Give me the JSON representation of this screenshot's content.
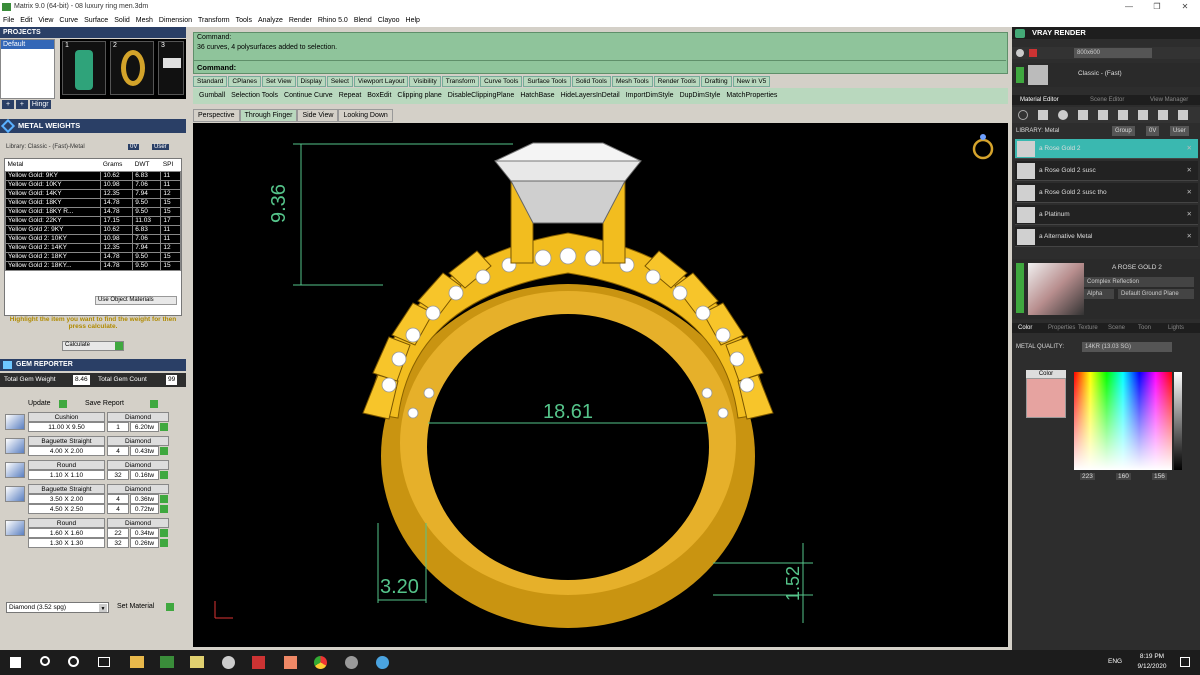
{
  "window": {
    "title": "Matrix 9.0 (64-bit) - 08 luxury ring men.3dm",
    "min": "—",
    "max": "❐",
    "close": "✕"
  },
  "menu": [
    "File",
    "Edit",
    "View",
    "Curve",
    "Surface",
    "Solid",
    "Mesh",
    "Dimension",
    "Transform",
    "Tools",
    "Analyze",
    "Render",
    "Rhino 5.0",
    "Blend",
    "Clayoo",
    "Help"
  ],
  "projects": {
    "title": "PROJECTS",
    "item": "Default",
    "thumbs": [
      "1",
      "2",
      "3"
    ],
    "hinge": "Hingr"
  },
  "metal": {
    "title": "METAL WEIGHTS",
    "library": "Library: Classic - (Fast)-Metal",
    "library_short": "0V",
    "user": "User",
    "headers": [
      "Metal",
      "Grams",
      "DWT",
      "SPI"
    ],
    "rows": [
      [
        "Yellow Gold: 9KY",
        "10.62",
        "6.83",
        "11"
      ],
      [
        "Yellow Gold: 10KY",
        "10.98",
        "7.06",
        "11"
      ],
      [
        "Yellow Gold: 14KY",
        "12.35",
        "7.94",
        "12"
      ],
      [
        "Yellow Gold: 18KY",
        "14.78",
        "9.50",
        "15"
      ],
      [
        "Yellow Gold: 18KY R...",
        "14.78",
        "9.50",
        "15"
      ],
      [
        "Yellow Gold: 22KY",
        "17.15",
        "11.03",
        "17"
      ],
      [
        "Yellow Gold 2: 9KY",
        "10.62",
        "6.83",
        "11"
      ],
      [
        "Yellow Gold 2: 10KY",
        "10.98",
        "7.06",
        "11"
      ],
      [
        "Yellow Gold 2: 14KY",
        "12.35",
        "7.94",
        "12"
      ],
      [
        "Yellow Gold 2: 18KY",
        "14.78",
        "9.50",
        "15"
      ],
      [
        "Yellow Gold 2: 18KY...",
        "14.78",
        "9.50",
        "15"
      ]
    ],
    "use_object": "Use Object Materials",
    "hint": "Highlight the item you want to find the weight for then press calculate.",
    "calculate": "Calculate"
  },
  "gems": {
    "title": "GEM REPORTER",
    "total_weight_label": "Total Gem Weight",
    "total_weight": "8.46",
    "total_count_label": "Total Gem Count",
    "total_count": "99",
    "update": "Update",
    "save_report": "Save Report",
    "groups": [
      {
        "shape": "Cushion",
        "material": "Diamond",
        "rows": [
          [
            "11.00 X 9.50",
            "1",
            "6.20tw"
          ]
        ]
      },
      {
        "shape": "Baguette Straight",
        "material": "Diamond",
        "rows": [
          [
            "4.00 X 2.00",
            "4",
            "0.43tw"
          ]
        ]
      },
      {
        "shape": "Round",
        "material": "Diamond",
        "rows": [
          [
            "1.10 X 1.10",
            "32",
            "0.16tw"
          ]
        ]
      },
      {
        "shape": "Baguette Straight",
        "material": "Diamond",
        "rows": [
          [
            "3.50 X 2.00",
            "4",
            "0.36tw"
          ],
          [
            "4.50 X 2.50",
            "4",
            "0.72tw"
          ]
        ]
      },
      {
        "shape": "Round",
        "material": "Diamond",
        "rows": [
          [
            "1.60 X 1.60",
            "22",
            "0.34tw"
          ],
          [
            "1.30 X 1.30",
            "32",
            "0.26tw"
          ]
        ]
      }
    ],
    "material_select": "Diamond    (3.52 spg)",
    "set_material": "Set Material"
  },
  "command": {
    "line1": "Command:",
    "line2": "36 curves, 4 polysurfaces added to selection.",
    "prompt": "Command:"
  },
  "toolbar_tabs": [
    "Standard",
    "CPlanes",
    "Set View",
    "Display",
    "Select",
    "Viewport Layout",
    "Visibility",
    "Transform",
    "Curve Tools",
    "Surface Tools",
    "Solid Tools",
    "Mesh Tools",
    "Render Tools",
    "Drafting",
    "New in V5"
  ],
  "tools": [
    "Gumball",
    "Selection Tools",
    "Continue Curve",
    "Repeat",
    "BoxEdit",
    "Clipping plane",
    "DisableClippingPlane",
    "HatchBase",
    "HideLayersInDetail",
    "ImportDimStyle",
    "DupDimStyle",
    "MatchProperties"
  ],
  "view_tabs": [
    "Perspective",
    "Through Finger",
    "Side View",
    "Looking Down"
  ],
  "active_view": "Through Finger",
  "dimensions": {
    "height": "9.36",
    "inner": "18.61",
    "shank": "3.20",
    "thickness": "1.52"
  },
  "vray": {
    "title": "VRAY RENDER",
    "resolution": "800x600",
    "preset": "Classic - (Fast)",
    "tabs": [
      "Material Editor",
      "Scene Editor",
      "View Manager"
    ],
    "library": "LIBRARY: Metal",
    "group": "Group",
    "short": "0V",
    "user": "User",
    "items": [
      "a Rose Gold 2",
      "a Rose Gold 2 susc",
      "a Rose Gold 2 susc tho",
      "a Platinum",
      "a Alternative Metal"
    ],
    "selected": "A ROSE GOLD 2",
    "reflection": "Complex Reflection",
    "alpha": "Alpha",
    "ground": "Default Ground Plane",
    "prop_tabs": [
      "Color",
      "Properties",
      "Texture",
      "Scene",
      "Toon",
      "Lights"
    ],
    "metal_quality_label": "METAL QUALITY:",
    "metal_quality": "14KR",
    "metal_quality_sg": "(13.03 SG)",
    "color_label": "Color",
    "swatch": "#e6a3a0",
    "rgb": [
      "223",
      "160",
      "156"
    ]
  },
  "taskbar": {
    "time": "8:19 PM",
    "date": "9/12/2020",
    "lang": "ENG"
  }
}
